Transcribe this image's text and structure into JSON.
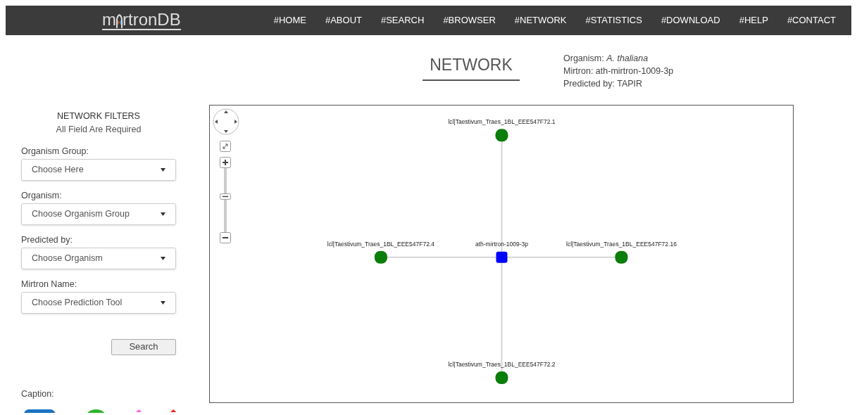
{
  "logo": {
    "left": "m",
    "right": "rtronDB"
  },
  "nav": [
    "#HOME",
    "#ABOUT",
    "#SEARCH",
    "#BROWSER",
    "#NETWORK",
    "#STATISTICS",
    "#DOWNLOAD",
    "#HELP",
    "#CONTACT"
  ],
  "page_title": "NETWORK",
  "info": [
    {
      "label": "Organism: ",
      "value": "*A. thaliana*"
    },
    {
      "label": "Mirtron: ",
      "value": "ath-mirtron-1009-3p"
    },
    {
      "label": "Predicted by: ",
      "value": "TAPIR"
    }
  ],
  "filters": {
    "title": "NETWORK FILTERS",
    "subtitle": "All Field Are Required",
    "fields": [
      {
        "label": "Organism Group:",
        "value": "Choose Here"
      },
      {
        "label": "Organism:",
        "value": "Choose Organism Group"
      },
      {
        "label": "Predicted by:",
        "value": "Choose Organism"
      },
      {
        "label": "Mirtron Name:",
        "value": "Choose Prediction Tool"
      }
    ],
    "button": "Search"
  },
  "caption": {
    "label": "Caption:",
    "shapes": [
      {
        "kind": "pill",
        "color": "#1a73c4"
      },
      {
        "kind": "circle",
        "color": "#2db52d"
      },
      {
        "kind": "diamond",
        "color": "#ee66dd"
      },
      {
        "kind": "diamond",
        "color": "#ee2222"
      }
    ]
  },
  "network": {
    "nodes": [
      {
        "label": "lcl|Taestivum_Traes_1BL_EEE547F72.1",
        "kind": "target",
        "color": "#0a7d0a"
      },
      {
        "label": "lcl|Taestivum_Traes_1BL_EEE547F72.4",
        "kind": "target",
        "color": "#0a7d0a"
      },
      {
        "label": "ath-mirtron-1009-3p",
        "kind": "mirtron",
        "color": "#0000ff"
      },
      {
        "label": "lcl|Taestivum_Traes_1BL_EEE547F72.16",
        "kind": "target",
        "color": "#0a7d0a"
      },
      {
        "label": "lcl|Taestivum_Traes_1BL_EEE547F72.2",
        "kind": "target",
        "color": "#0a7d0a"
      }
    ]
  }
}
